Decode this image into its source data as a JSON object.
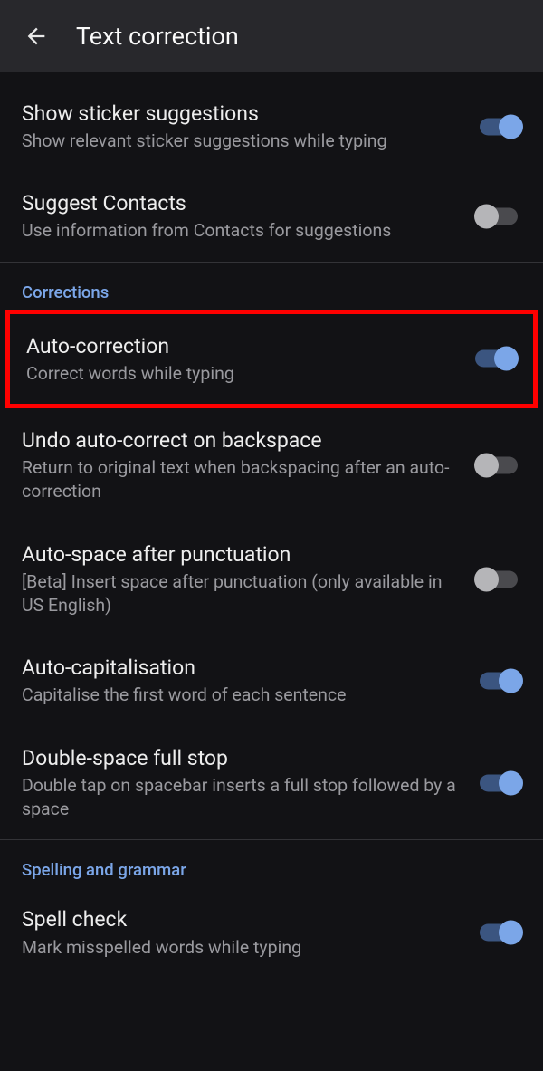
{
  "header": {
    "title": "Text correction"
  },
  "settings": {
    "sticker": {
      "title": "Show sticker suggestions",
      "subtitle": "Show relevant sticker suggestions while typing"
    },
    "contacts": {
      "title": "Suggest Contacts",
      "subtitle": "Use information from Contacts for suggestions"
    },
    "autocorrect": {
      "title": "Auto-correction",
      "subtitle": "Correct words while typing"
    },
    "undo": {
      "title": "Undo auto-correct on backspace",
      "subtitle": "Return to original text when backspacing after an auto-correction"
    },
    "autospace": {
      "title": "Auto-space after punctuation",
      "subtitle": "[Beta] Insert space after punctuation (only available in US English)"
    },
    "autocap": {
      "title": "Auto-capitalisation",
      "subtitle": "Capitalise the first word of each sentence"
    },
    "doublespace": {
      "title": "Double-space full stop",
      "subtitle": "Double tap on spacebar inserts a full stop followed by a space"
    },
    "spellcheck": {
      "title": "Spell check",
      "subtitle": "Mark misspelled words while typing"
    }
  },
  "sections": {
    "corrections": "Corrections",
    "spelling": "Spelling and grammar"
  }
}
